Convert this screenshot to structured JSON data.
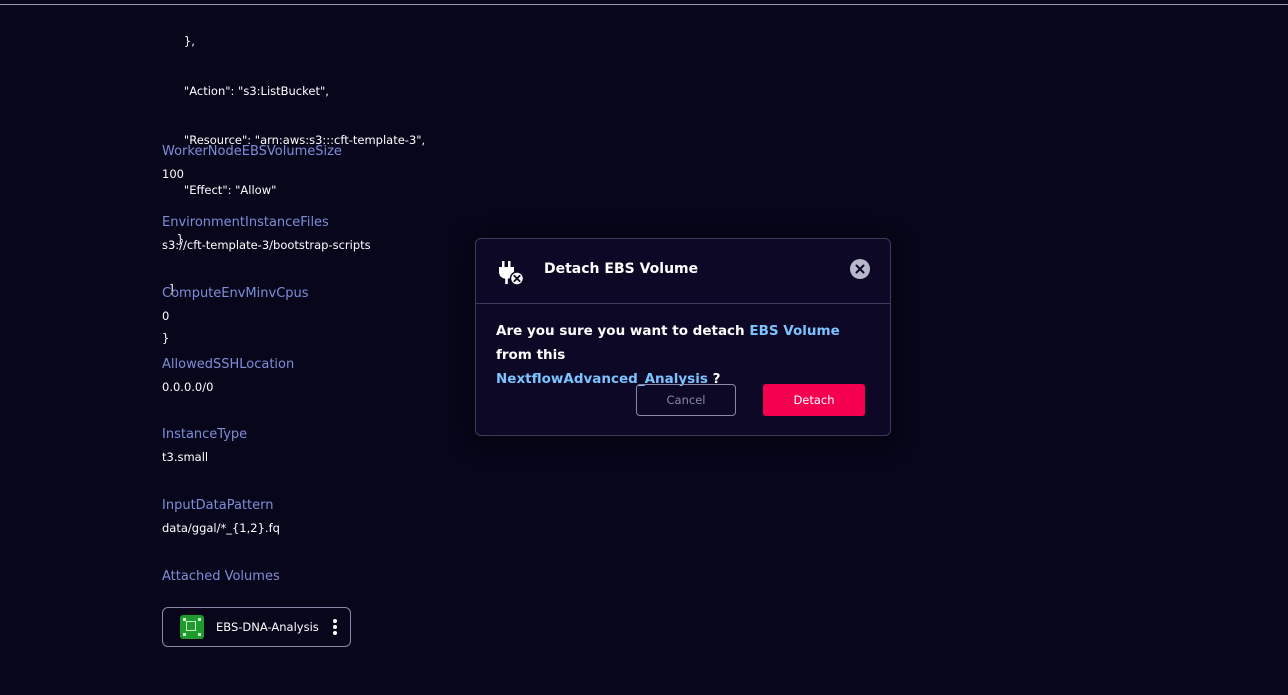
{
  "policy_tail": {
    "lines": [
      "      },",
      "      \"Action\": \"s3:ListBucket\",",
      "      \"Resource\": \"arn:aws:s3:::cft-template-3\",",
      "      \"Effect\": \"Allow\"",
      "    }",
      "  ]",
      "}"
    ]
  },
  "fields": [
    {
      "label": "WorkerNodeEBSVolumeSize",
      "value": "100"
    },
    {
      "label": "EnvironmentInstanceFiles",
      "value": "s3://cft-template-3/bootstrap-scripts"
    },
    {
      "label": "ComputeEnvMinvCpus",
      "value": "0"
    },
    {
      "label": "AllowedSSHLocation",
      "value": "0.0.0.0/0"
    },
    {
      "label": "InstanceType",
      "value": "t3.small"
    },
    {
      "label": "InputDataPattern",
      "value": "data/ggal/*_{1,2}.fq"
    }
  ],
  "volumes": {
    "label": "Attached Volumes",
    "items": [
      {
        "name": "EBS-DNA-Analysis",
        "icon": "ebs-volume-icon"
      }
    ]
  },
  "modal": {
    "title": "Detach EBS Volume",
    "icon": "unplug-icon",
    "message_prefix": "Are you sure you want to detach",
    "message_highlight_1": "EBS Volume",
    "message_mid": "from this",
    "message_highlight_2": "NextflowAdvanced_Analysis",
    "message_suffix": "?",
    "cancel_label": "Cancel",
    "detach_label": "Detach",
    "colors": {
      "accent": "#f5004f",
      "highlight": "#7cc3ff",
      "label": "#7f8dd8"
    }
  }
}
